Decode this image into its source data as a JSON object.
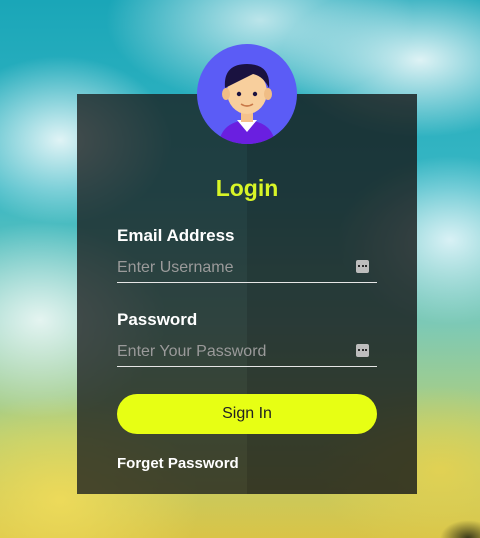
{
  "login": {
    "title": "Login",
    "email_label": "Email Address",
    "email_placeholder": "Enter Username",
    "password_label": "Password",
    "password_placeholder": "Enter Your Password",
    "signin_label": "Sign In",
    "forget_label": "Forget Password"
  },
  "colors": {
    "accent": "#e7ff14",
    "title": "#d8f527",
    "avatar_bg": "#5b5cf6"
  },
  "icons": {
    "avatar": "user-avatar-icon",
    "field_key": "password-manager-key-icon"
  }
}
